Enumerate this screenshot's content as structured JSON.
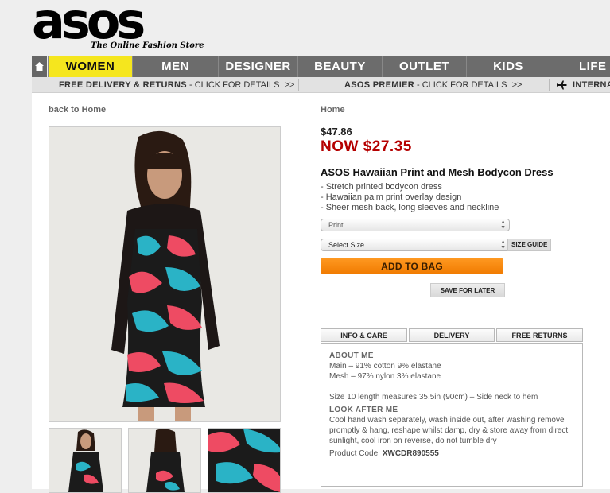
{
  "brand": {
    "logo": "asos",
    "tagline": "The Online Fashion Store"
  },
  "nav": {
    "items": [
      {
        "label": "WOMEN"
      },
      {
        "label": "MEN"
      },
      {
        "label": "DESIGNER"
      },
      {
        "label": "BEAUTY"
      },
      {
        "label": "OUTLET"
      },
      {
        "label": "KIDS"
      },
      {
        "label": "LIFE"
      }
    ],
    "active": "WOMEN"
  },
  "promo": {
    "delivery_bold": "FREE DELIVERY & RETURNS",
    "delivery_rest": " - CLICK FOR DETAILS  >>",
    "premier_bold": "ASOS PREMIER",
    "premier_rest": " - CLICK FOR DETAILS  >>",
    "international": "INTERNA"
  },
  "breadcrumbs": {
    "back": "back to Home",
    "home": "Home"
  },
  "product": {
    "old_price": "$47.86",
    "now_price": "NOW $27.35",
    "title": "ASOS Hawaiian Print and Mesh Bodycon Dress",
    "features": [
      "- Stretch printed bodycon dress",
      "- Hawaiian palm print overlay design",
      "- Sheer mesh back, long sleeves and neckline"
    ],
    "colour_select": "Print",
    "size_select": "Select Size",
    "size_guide": "SIZE GUIDE",
    "add_to_bag": "ADD TO BAG",
    "save_for_later": "SAVE FOR LATER"
  },
  "tabs": [
    {
      "label": "INFO & CARE"
    },
    {
      "label": "DELIVERY"
    },
    {
      "label": "FREE RETURNS"
    }
  ],
  "info": {
    "about_heading": "ABOUT ME",
    "about_lines": [
      "Main – 91% cotton 9% elastane",
      "Mesh – 97% nylon 3% elastane"
    ],
    "size_note": "Size 10 length measures 35.5in (90cm) – Side neck to hem",
    "care_heading": "LOOK AFTER ME",
    "care_text": "Cool hand wash separately, wash inside out, after washing remove promptly & hang, reshape whilst damp, dry & store away from direct sunlight, cool iron on reverse, do not tumble dry",
    "code_label": "Product Code:",
    "code_value": "XWCDR890555"
  },
  "colors": {
    "accent": "#f5e61e",
    "sale": "#b50000",
    "cta": "#f58a0c",
    "nav": "#6c6c6c"
  },
  "icons": [
    "home-icon",
    "airplane-icon",
    "dropdown-arrows-icon"
  ]
}
